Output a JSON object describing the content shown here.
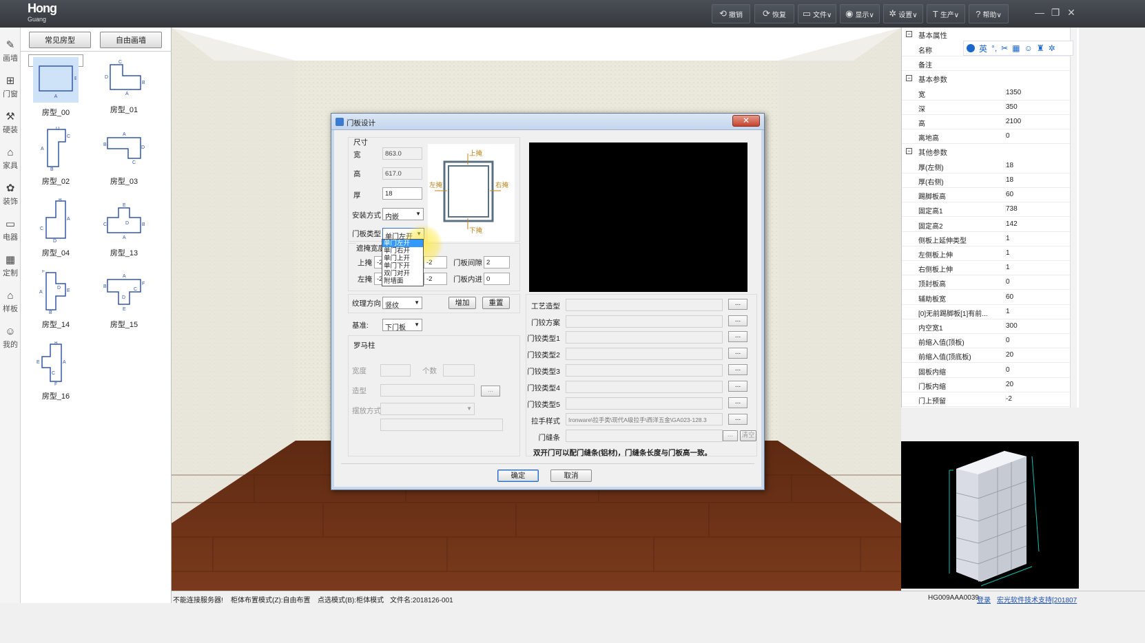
{
  "app": {
    "logo_main": "Hong",
    "logo_sub": "Guang"
  },
  "toolbar": [
    {
      "icon": "undo-icon",
      "glyph": "⟲",
      "label": "撤销"
    },
    {
      "icon": "redo-icon",
      "glyph": "⟳",
      "label": "恢复"
    },
    {
      "icon": "file-icon",
      "glyph": "▭",
      "label": "文件∨"
    },
    {
      "icon": "eye-icon",
      "glyph": "◉",
      "label": "显示∨"
    },
    {
      "icon": "gear-icon",
      "glyph": "✲",
      "label": "设置∨"
    },
    {
      "icon": "production-icon",
      "glyph": "T",
      "label": "生产∨"
    },
    {
      "icon": "help-icon",
      "glyph": "?",
      "label": "帮助∨"
    }
  ],
  "window_controls": {
    "minimize": "—",
    "restore": "❐",
    "close": "✕"
  },
  "rail": [
    {
      "name": "draw-wall",
      "glyph": "✎",
      "label": "画墙"
    },
    {
      "name": "door-window",
      "glyph": "⊞",
      "label": "门窗"
    },
    {
      "name": "hardware",
      "glyph": "⚒",
      "label": "硬装"
    },
    {
      "name": "furniture",
      "glyph": "⌂",
      "label": "家具"
    },
    {
      "name": "decoration",
      "glyph": "✿",
      "label": "装饰"
    },
    {
      "name": "appliance",
      "glyph": "▭",
      "label": "电器"
    },
    {
      "name": "custom",
      "glyph": "▦",
      "label": "定制"
    },
    {
      "name": "template",
      "glyph": "⌂",
      "label": "样板"
    },
    {
      "name": "mine",
      "glyph": "☺",
      "label": "我的"
    }
  ],
  "room_panel": {
    "tab_common": "常见房型",
    "tab_free": "自由画墙",
    "rooms": [
      "房型_00",
      "房型_01",
      "房型_02",
      "房型_03",
      "房型_04",
      "房型_13",
      "房型_14",
      "房型_15",
      "房型_16"
    ]
  },
  "dialog": {
    "title": "门板设计",
    "close": "✕",
    "size_group": "尺寸",
    "width_label": "宽",
    "width_value": "863.0",
    "height_label": "高",
    "height_value": "617.0",
    "thick_label": "厚",
    "thick_value": "18",
    "install_label": "安装方式",
    "install_value": "内嵌",
    "door_type_label": "门板类型",
    "door_type_value": "单门左开",
    "door_type_options": [
      "单门左开",
      "单门右开",
      "单门上开",
      "单门下开",
      "双门对开",
      "附墙面"
    ],
    "cover_group": "遮掩宽度",
    "top_label": "上掩",
    "top_value": "-2",
    "top_value2": "-2",
    "left_label": "左掩",
    "left_value": "-2",
    "left_value2": "-2",
    "gap_label": "门板间隙",
    "gap_value": "2",
    "inset_label": "门板内进",
    "inset_value": "0",
    "diagram_top": "上掩",
    "diagram_bottom": "下掩",
    "diagram_left": "左掩",
    "diagram_right": "右掩",
    "grain_label": "纹理方向",
    "grain_value": "竖纹",
    "add_btn": "增加",
    "reset_btn": "重置",
    "base_label": "基准:",
    "base_value": "下门板",
    "roman_group": "罗马柱",
    "roman_width_label": "宽度",
    "roman_count_label": "个数",
    "roman_shape_label": "造型",
    "roman_place_label": "摆放方式",
    "craft_label": "工艺造型",
    "hinge_scheme_label": "门铰方案",
    "hinge1_label": "门铰类型1",
    "hinge2_label": "门铰类型2",
    "hinge3_label": "门铰类型3",
    "hinge4_label": "门铰类型4",
    "hinge5_label": "门铰类型5",
    "handle_label": "拉手样式",
    "handle_value": "Ironware\\拉手类\\现代A级拉手\\西洋五金\\GA023-128.3",
    "seal_label": "门缝条",
    "clear_btn": "清空",
    "dots": "...",
    "note": "双开门可以配门缝条(铝材)，门缝条长度与门板高一致。",
    "ok": "确定",
    "cancel": "取消"
  },
  "props": {
    "groups": [
      {
        "title": "基本属性",
        "rows": [
          [
            "名称",
            ""
          ],
          [
            "备注",
            ""
          ]
        ]
      },
      {
        "title": "基本参数",
        "rows": [
          [
            "宽",
            "1350"
          ],
          [
            "深",
            "350"
          ],
          [
            "高",
            "2100"
          ],
          [
            "离地高",
            "0"
          ]
        ]
      },
      {
        "title": "其他参数",
        "rows": [
          [
            "厚(左侧)",
            "18"
          ],
          [
            "厚(右侧)",
            "18"
          ],
          [
            "踢脚板高",
            "60"
          ],
          [
            "固定高1",
            "738"
          ],
          [
            "固定高2",
            "142"
          ],
          [
            "侧板上延伸类型",
            "1"
          ],
          [
            "左侧板上伸",
            "1"
          ],
          [
            "右侧板上伸",
            "1"
          ],
          [
            "顶封板高",
            "0"
          ],
          [
            "辅助板宽",
            "60"
          ],
          [
            "[0]无前踢脚板[1]有前...",
            "1"
          ],
          [
            "内空宽1",
            "300"
          ],
          [
            "前缩入值(顶板)",
            "0"
          ],
          [
            "前缩入值(顶底板)",
            "20"
          ],
          [
            "固板内缩",
            "0"
          ],
          [
            "门板内缩",
            "20"
          ],
          [
            "门上预留",
            "-2"
          ]
        ]
      }
    ],
    "ime": "英"
  },
  "status": {
    "server": "不能连接服务器!",
    "layout_mode": "柜体布置模式(Z):自由布置",
    "select_mode": "点选模式(B):柜体模式",
    "filename": "文件名:2018126-001",
    "code": "HG009AAA0039",
    "login": "登录",
    "support": "宏光软件技术支持[201807"
  },
  "colors": {
    "accent": "#3399ff",
    "topbar": "#3d4248",
    "floor": "#6b2e14",
    "wall": "#ece9df"
  }
}
